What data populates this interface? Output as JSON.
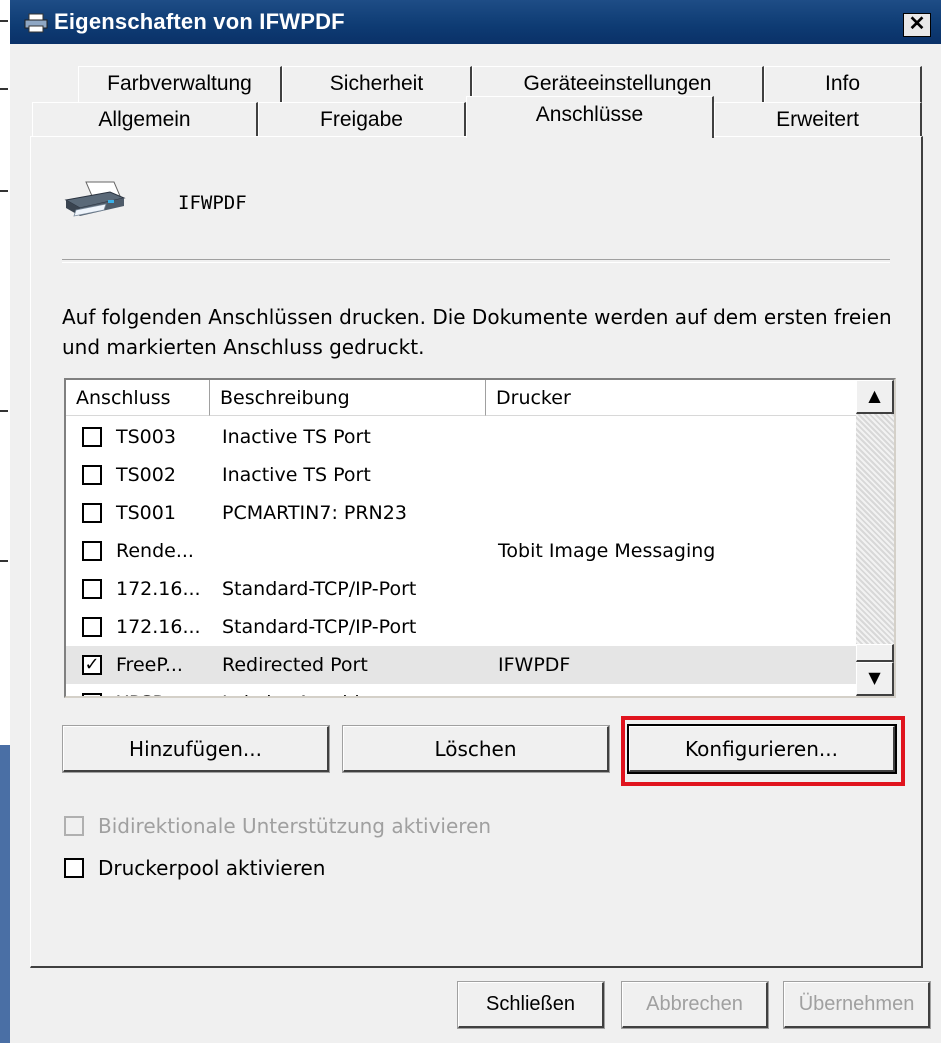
{
  "window": {
    "title": "Eigenschaften von IFWPDF",
    "close_glyph": "✕"
  },
  "tabs_row1": [
    "Farbverwaltung",
    "Sicherheit",
    "Geräteeinstellungen",
    "Info"
  ],
  "tabs_row2": [
    "Allgemein",
    "Freigabe",
    "Anschlüsse",
    "Erweitert"
  ],
  "active_tab": "Anschlüsse",
  "printer": {
    "name": "IFWPDF",
    "icon": "printer-icon"
  },
  "instructions": "Auf folgenden Anschlüssen drucken. Die Dokumente werden auf dem ersten freien und markierten Anschluss gedruckt.",
  "ports_table": {
    "columns": [
      "Anschluss",
      "Beschreibung",
      "Drucker"
    ],
    "rows": [
      {
        "checked": false,
        "port": "TS003",
        "description": "Inactive TS Port",
        "printer": ""
      },
      {
        "checked": false,
        "port": "TS002",
        "description": "Inactive TS Port",
        "printer": ""
      },
      {
        "checked": false,
        "port": "TS001",
        "description": "PCMARTIN7:  PRN23",
        "printer": ""
      },
      {
        "checked": false,
        "port": "Rende...",
        "description": "",
        "printer": "Tobit Image Messaging"
      },
      {
        "checked": false,
        "port": "172.16...",
        "description": "Standard-TCP/IP-Port",
        "printer": ""
      },
      {
        "checked": false,
        "port": "172.16...",
        "description": "Standard-TCP/IP-Port",
        "printer": ""
      },
      {
        "checked": true,
        "port": "FreeP...",
        "description": "Redirected Port",
        "printer": "IFWPDF"
      },
      {
        "checked": false,
        "port": "XPSP...",
        "description": "Lokaler Anschluss",
        "printer": ""
      }
    ],
    "selected_row": 6,
    "scroll_up": "▲",
    "scroll_down": "▼"
  },
  "port_buttons": {
    "add": "Hinzufügen...",
    "delete": "Löschen",
    "configure": "Konfigurieren..."
  },
  "options": {
    "bidirectional": {
      "label": "Bidirektionale Unterstützung aktivieren",
      "checked": false,
      "enabled": false
    },
    "pool": {
      "label": "Druckerpool aktivieren",
      "checked": false,
      "enabled": true
    }
  },
  "footer": {
    "close": "Schließen",
    "cancel": "Abbrechen",
    "apply": "Übernehmen"
  },
  "colors": {
    "titlebar": "#0e3b73",
    "highlight": "#e0141e",
    "face": "#f0f0f0"
  }
}
